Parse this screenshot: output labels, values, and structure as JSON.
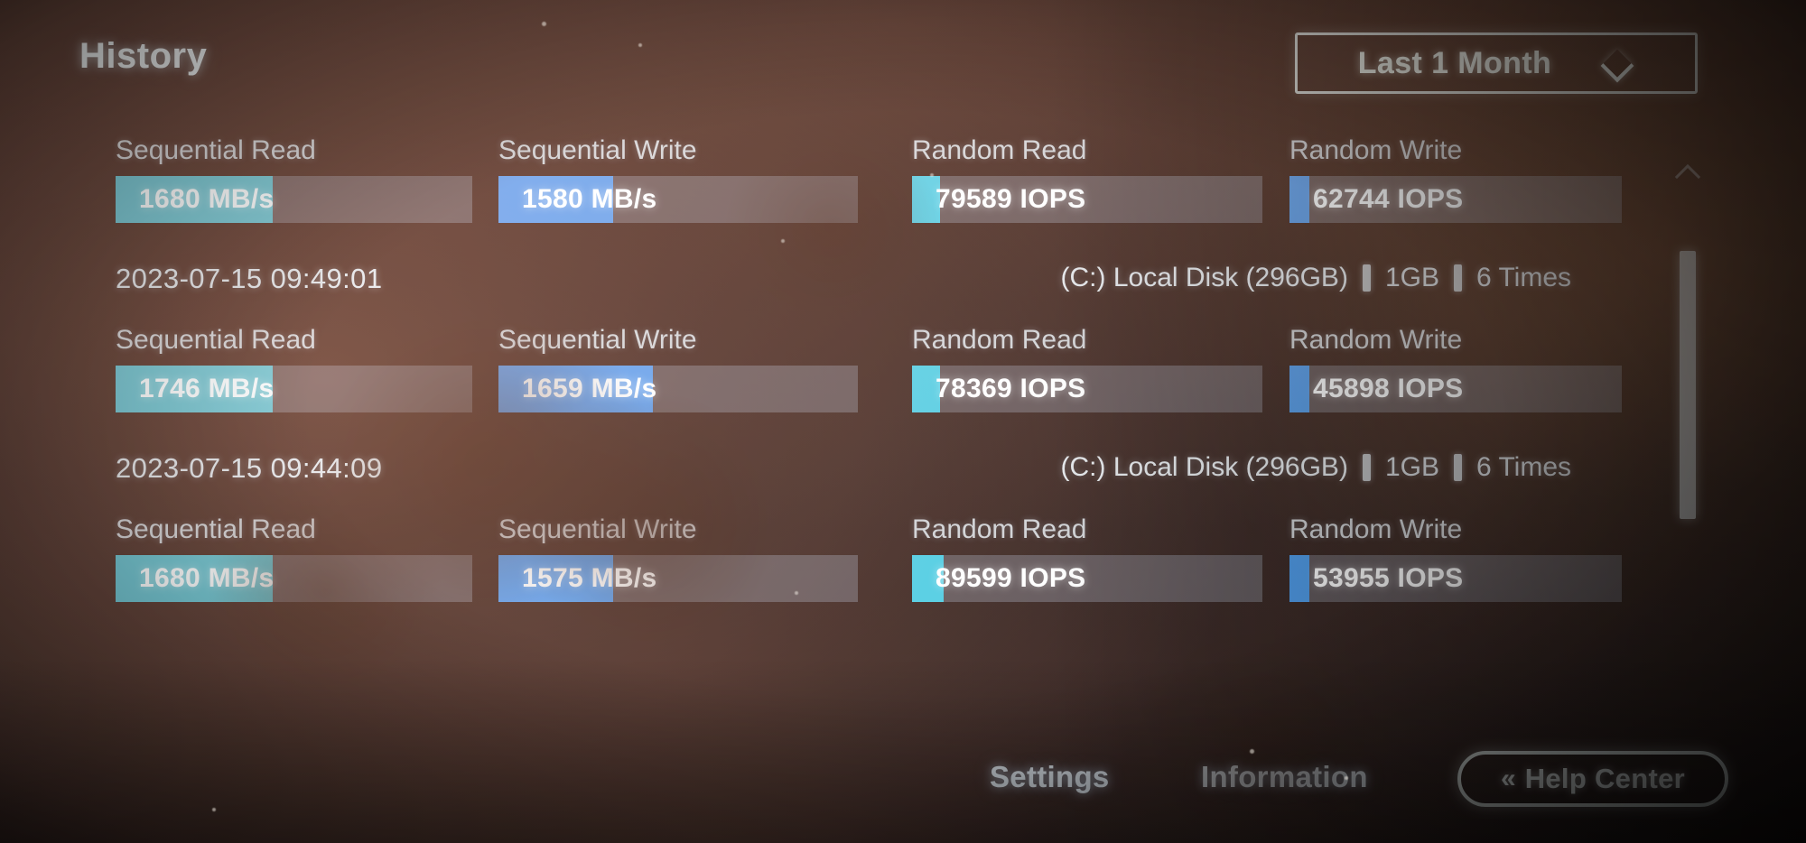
{
  "header": {
    "title": "History",
    "period_dropdown": {
      "value": "Last 1 Month",
      "icon": "chevron-down-icon"
    }
  },
  "metric_labels": {
    "sequential_read": "Sequential Read",
    "sequential_write": "Sequential Write",
    "random_read": "Random Read",
    "random_write": "Random Write"
  },
  "colors": {
    "seq_read_fill": "#27b9cc",
    "seq_write_fill": "#2590e8",
    "rnd_read_fill": "#1fc6e0",
    "rnd_write_fill": "#2590e8",
    "track": "#3b4450",
    "accent_text": "#ffffff"
  },
  "entries": [
    {
      "metrics": [
        {
          "label": "Sequential Read",
          "value": "1680 MB/s",
          "fill_pct": 44,
          "color": "#27b9cc"
        },
        {
          "label": "Sequential Write",
          "value": "1580 MB/s",
          "fill_pct": 32,
          "color": "#2590e8"
        },
        {
          "label": "Random Read",
          "value": "79589 IOPS",
          "fill_pct": 8,
          "color": "#1fc6e0"
        },
        {
          "label": "Random Write",
          "value": "62744 IOPS",
          "fill_pct": 6,
          "color": "#2590e8"
        }
      ],
      "timestamp": "2023-07-15 09:49:01",
      "disk": "(C:) Local Disk (296GB)",
      "size": "1GB",
      "times": "6 Times"
    },
    {
      "metrics": [
        {
          "label": "Sequential Read",
          "value": "1746 MB/s",
          "fill_pct": 44,
          "color": "#27b9cc"
        },
        {
          "label": "Sequential Write",
          "value": "1659 MB/s",
          "fill_pct": 43,
          "color": "#2590e8"
        },
        {
          "label": "Random Read",
          "value": "78369 IOPS",
          "fill_pct": 8,
          "color": "#1fc6e0"
        },
        {
          "label": "Random Write",
          "value": "45898 IOPS",
          "fill_pct": 6,
          "color": "#2590e8"
        }
      ],
      "timestamp": "2023-07-15 09:44:09",
      "disk": "(C:) Local Disk (296GB)",
      "size": "1GB",
      "times": "6 Times"
    },
    {
      "metrics": [
        {
          "label": "Sequential Read",
          "value": "1680 MB/s",
          "fill_pct": 44,
          "color": "#27b9cc"
        },
        {
          "label": "Sequential Write",
          "value": "1575 MB/s",
          "fill_pct": 32,
          "color": "#2590e8"
        },
        {
          "label": "Random Read",
          "value": "89599 IOPS",
          "fill_pct": 9,
          "color": "#1fc6e0"
        },
        {
          "label": "Random Write",
          "value": "53955 IOPS",
          "fill_pct": 6,
          "color": "#2590e8"
        }
      ],
      "timestamp": null,
      "disk": null,
      "size": null,
      "times": null
    }
  ],
  "scrollbar": {
    "up_icon": "chevron-up-icon",
    "thumb_top_pct": 19,
    "thumb_height_pct": 48
  },
  "footer": {
    "settings_label": "Settings",
    "information_label": "Information",
    "help_center": {
      "label": "Help Center",
      "icon": "double-chevron-left-icon",
      "icon_glyph": "«"
    }
  }
}
